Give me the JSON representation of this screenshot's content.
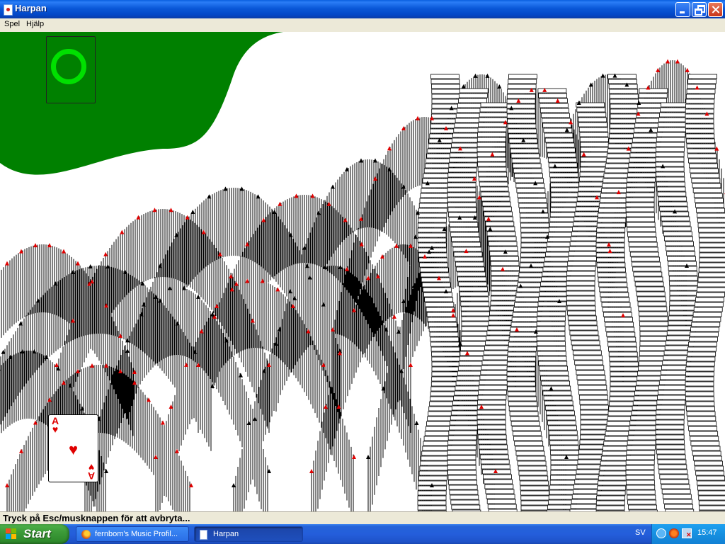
{
  "window": {
    "title": "Harpan",
    "controls": [
      "minimize-icon",
      "maximize-icon",
      "close-icon"
    ]
  },
  "menu": {
    "items": [
      "Spel",
      "Hjälp"
    ]
  },
  "game": {
    "felt_color": "#008000",
    "deck_ring_color": "#00e000",
    "front_card": {
      "rank": "A",
      "suit": "♥",
      "color": "#e00000"
    }
  },
  "status": {
    "text": "Tryck på Esc/musknappen för att avbryta..."
  },
  "taskbar": {
    "start_label": "Start",
    "tasks": [
      {
        "label": "fernbom's Music Profil...",
        "icon": "firefox-icon"
      },
      {
        "label": "Harpan",
        "icon": "solitaire-icon",
        "active": true
      }
    ],
    "language": "SV",
    "clock": "15:47"
  }
}
